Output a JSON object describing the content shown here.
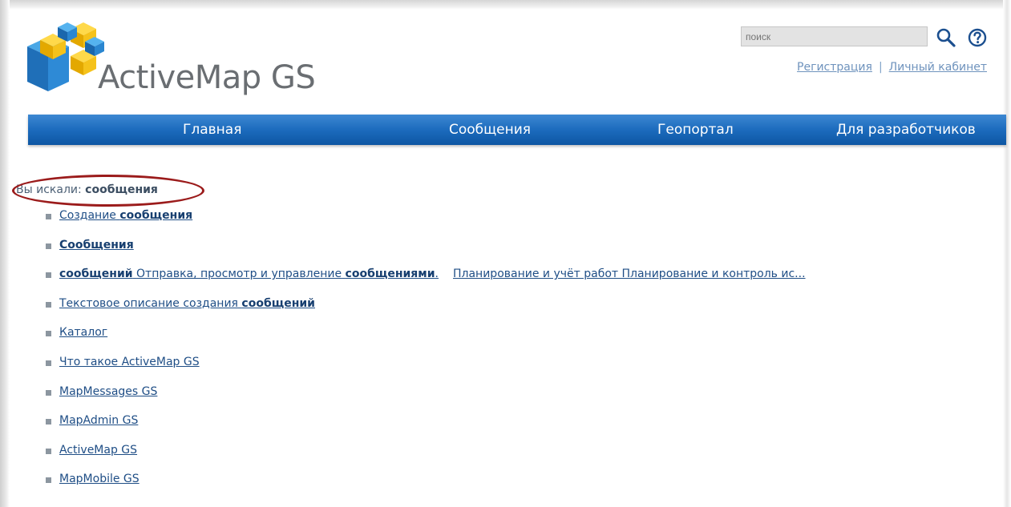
{
  "brand": {
    "name": "ActiveMap GS"
  },
  "search": {
    "placeholder": "поиск"
  },
  "account": {
    "register": "Регистрация",
    "separator": "|",
    "cabinet": "Личный кабинет"
  },
  "nav": {
    "items": [
      "Главная",
      "Сообщения",
      "Геопортал",
      "Для разработчиков"
    ]
  },
  "query": {
    "prefix": "Вы искали:",
    "term": "сообщения"
  },
  "results": [
    {
      "before": "Создание",
      "bold": "сообщения",
      "after": ""
    },
    {
      "before": "",
      "bold": "Сообщения",
      "after": ""
    },
    {
      "before": "",
      "bold": "сообщений",
      "mid": "Отправка, просмотр и управление",
      "bold2": "сообщениями",
      "after": ".",
      "extra": "Планирование и учёт работ  Планирование и контроль ис..."
    },
    {
      "before": "Текстовое описание создания",
      "bold": "сообщений",
      "after": ""
    },
    {
      "before": "Каталог"
    },
    {
      "before": "Что такое ActiveMap GS"
    },
    {
      "before": "MapMessages GS"
    },
    {
      "before": "MapAdmin GS"
    },
    {
      "before": "ActiveMap GS"
    },
    {
      "before": "MapMobile GS"
    }
  ],
  "colors": {
    "nav_bg": "#1c6bbd",
    "link": "#1f4e86",
    "highlight": "#9b1b1b"
  },
  "icons": {
    "search": "magnifier-icon",
    "help": "question-circle-icon"
  }
}
